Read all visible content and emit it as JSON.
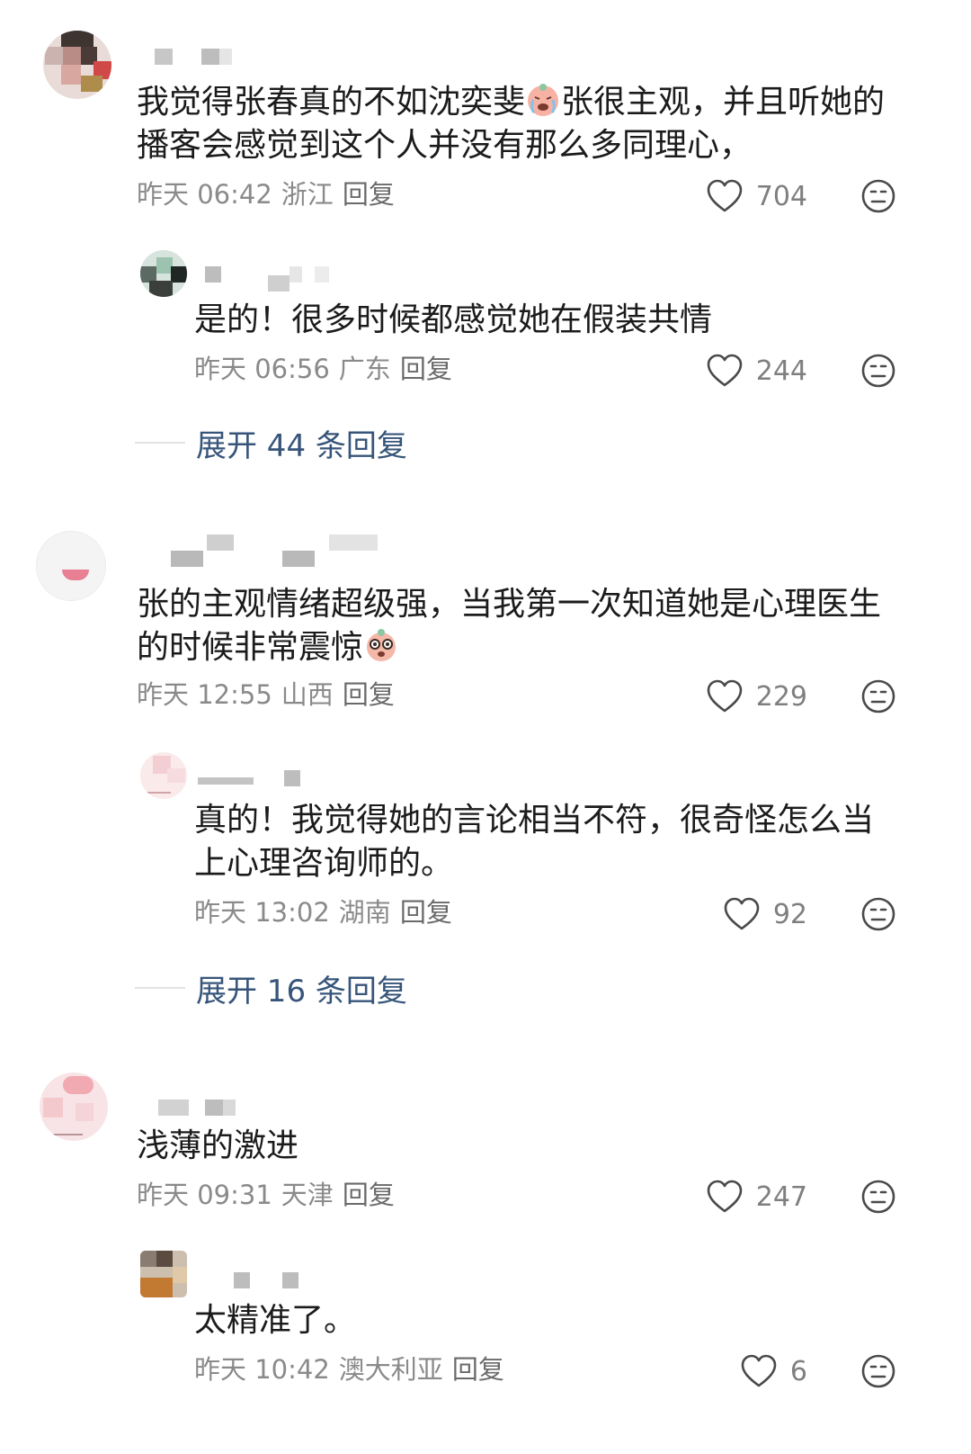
{
  "comments": [
    {
      "text_line1": "我觉得张春真的不如沈奕斐",
      "text_line1_rest": "张很主观，并且听她的",
      "text_line2": "播客会感觉到这个人并没有那么多同理心，",
      "time": "昨天 06:42",
      "location": "浙江",
      "reply_label": "回复",
      "likes": "704",
      "reply": {
        "text": "是的！很多时候都感觉她在假装共情",
        "time": "昨天 06:56",
        "location": "广东",
        "reply_label": "回复",
        "likes": "244"
      },
      "expand_label": "展开 44 条回复"
    },
    {
      "text_line1": "张的主观情绪超级强，当我第一次知道她是心理医生",
      "text_line2": "的时候非常震惊",
      "time": "昨天 12:55",
      "location": "山西",
      "reply_label": "回复",
      "likes": "229",
      "reply": {
        "text_line1": "真的！我觉得她的言论相当不符，很奇怪怎么当",
        "text_line2": "上心理咨询师的。",
        "time": "昨天 13:02",
        "location": "湖南",
        "reply_label": "回复",
        "likes": "92"
      },
      "expand_label": "展开 16 条回复"
    },
    {
      "text_line1": "浅薄的激进",
      "time": "昨天 09:31",
      "location": "天津",
      "reply_label": "回复",
      "likes": "247",
      "reply": {
        "text": "太精准了。",
        "time": "昨天 10:42",
        "location": "澳大利亚",
        "reply_label": "回复",
        "likes": "6"
      }
    }
  ],
  "icons": {
    "like": "heart-outline-icon",
    "dislike": "neutral-face-icon",
    "emoji_1": "crying-face-emoji",
    "emoji_2": "shocked-face-emoji"
  },
  "colors": {
    "text": "#1b1b1b",
    "meta": "#8a8a8a",
    "expand": "#37557a"
  }
}
